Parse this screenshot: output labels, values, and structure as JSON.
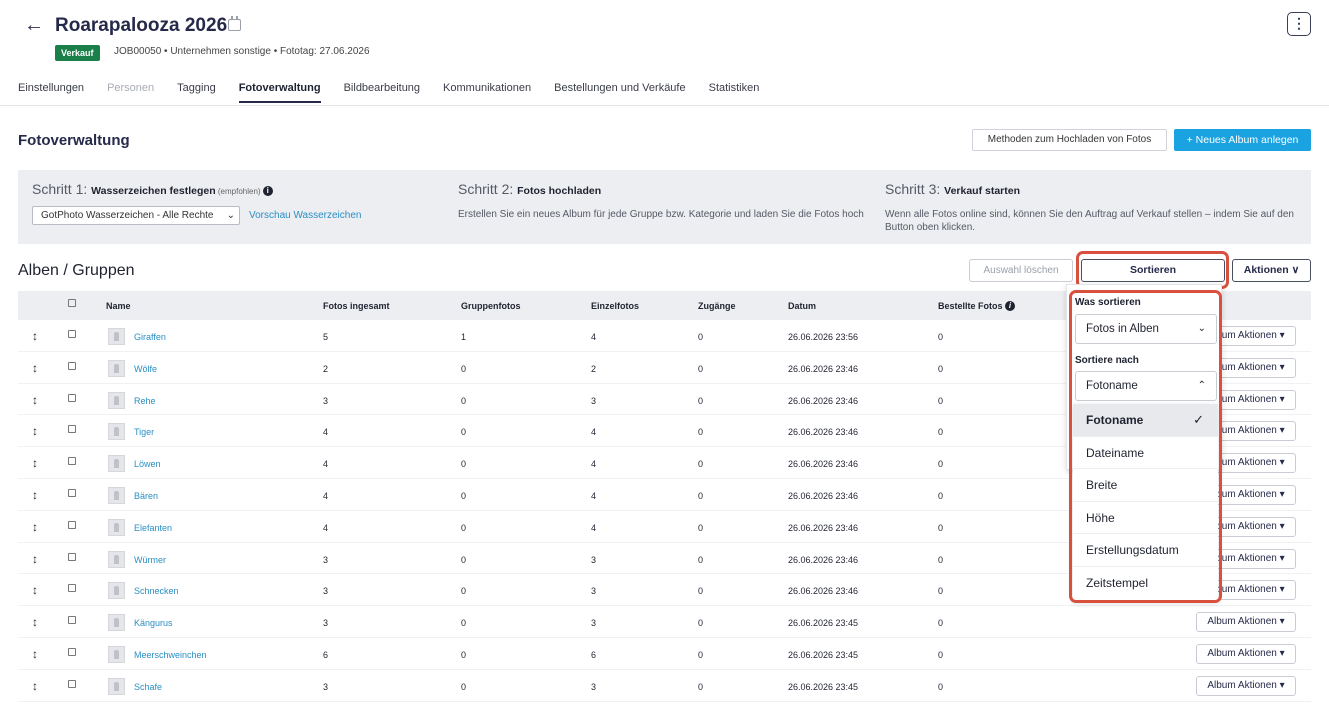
{
  "header": {
    "title": "Roarapalooza 2026",
    "badge": "Verkauf",
    "meta": "JOB00050  •  Unternehmen sonstige  •  Fototag: 27.06.2026",
    "more": "⋮"
  },
  "tabs": [
    "Einstellungen",
    "Personen",
    "Tagging",
    "Fotoverwaltung",
    "Bildbearbeitung",
    "Kommunikationen",
    "Bestellungen und Verkäufe",
    "Statistiken"
  ],
  "section": {
    "title": "Fotoverwaltung",
    "upload_methods": "Methoden zum Hochladen von Fotos",
    "new_album": "+  Neues Album anlegen"
  },
  "steps": {
    "s1_prefix": "Schritt 1: ",
    "s1_title": "Wasserzeichen festlegen",
    "s1_note": " (empfohlen) ",
    "s1_select": "GotPhoto Wasserzeichen - Alle Rechte",
    "s1_link": "Vorschau Wasserzeichen",
    "s2_prefix": "Schritt 2: ",
    "s2_title": "Fotos hochladen",
    "s2_text": "Erstellen Sie ein neues Album für jede Gruppe bzw. Kategorie und laden Sie die Fotos hoch",
    "s3_prefix": "Schritt 3: ",
    "s3_title": "Verkauf starten",
    "s3_text": "Wenn alle Fotos online sind, können Sie den Auftrag auf Verkauf stellen – indem Sie auf den Button oben klicken."
  },
  "albums": {
    "title": "Alben / Gruppen",
    "clear": "Auswahl löschen",
    "sort": "Sortieren",
    "actions": "Aktionen ∨"
  },
  "table": {
    "columns": [
      "Name",
      "Fotos ingesamt",
      "Gruppenfotos",
      "Einzelfotos",
      "Zugänge",
      "Datum",
      "Bestellte Fotos"
    ],
    "row_action": "Album Aktionen ▾",
    "rows": [
      {
        "name": "Giraffen",
        "total": "5",
        "group": "1",
        "single": "4",
        "access": "0",
        "date": "26.06.2026 23:56",
        "ordered": "0"
      },
      {
        "name": "Wölfe",
        "total": "2",
        "group": "0",
        "single": "2",
        "access": "0",
        "date": "26.06.2026 23:46",
        "ordered": "0"
      },
      {
        "name": "Rehe",
        "total": "3",
        "group": "0",
        "single": "3",
        "access": "0",
        "date": "26.06.2026 23:46",
        "ordered": "0"
      },
      {
        "name": "Tiger",
        "total": "4",
        "group": "0",
        "single": "4",
        "access": "0",
        "date": "26.06.2026 23:46",
        "ordered": "0"
      },
      {
        "name": "Löwen",
        "total": "4",
        "group": "0",
        "single": "4",
        "access": "0",
        "date": "26.06.2026 23:46",
        "ordered": "0"
      },
      {
        "name": "Bären",
        "total": "4",
        "group": "0",
        "single": "4",
        "access": "0",
        "date": "26.06.2026 23:46",
        "ordered": "0"
      },
      {
        "name": "Elefanten",
        "total": "4",
        "group": "0",
        "single": "4",
        "access": "0",
        "date": "26.06.2026 23:46",
        "ordered": "0"
      },
      {
        "name": "Würmer",
        "total": "3",
        "group": "0",
        "single": "3",
        "access": "0",
        "date": "26.06.2026 23:46",
        "ordered": "0"
      },
      {
        "name": "Schnecken",
        "total": "3",
        "group": "0",
        "single": "3",
        "access": "0",
        "date": "26.06.2026 23:46",
        "ordered": "0"
      },
      {
        "name": "Kängurus",
        "total": "3",
        "group": "0",
        "single": "3",
        "access": "0",
        "date": "26.06.2026 23:45",
        "ordered": "0"
      },
      {
        "name": "Meerschweinchen",
        "total": "6",
        "group": "0",
        "single": "6",
        "access": "0",
        "date": "26.06.2026 23:45",
        "ordered": "0"
      },
      {
        "name": "Schafe",
        "total": "3",
        "group": "0",
        "single": "3",
        "access": "0",
        "date": "26.06.2026 23:45",
        "ordered": "0"
      }
    ]
  },
  "sort_menu": {
    "what_label": "Was sortieren",
    "what_value": "Fotos in Alben",
    "by_label": "Sortiere nach",
    "by_value": "Fotoname",
    "options": [
      "Fotoname",
      "Dateiname",
      "Breite",
      "Höhe",
      "Erstellungsdatum",
      "Zeitstempel"
    ]
  },
  "icons": {
    "back": "arrow-left-icon",
    "calendar": "calendar-icon",
    "info": "info-icon",
    "drag": "drag-handle-icon",
    "check": "check-icon"
  },
  "colors": {
    "accent": "#1aa3e0",
    "badge": "#1b7f4a",
    "highlight": "#d9503e",
    "link": "#2a8fc5"
  }
}
